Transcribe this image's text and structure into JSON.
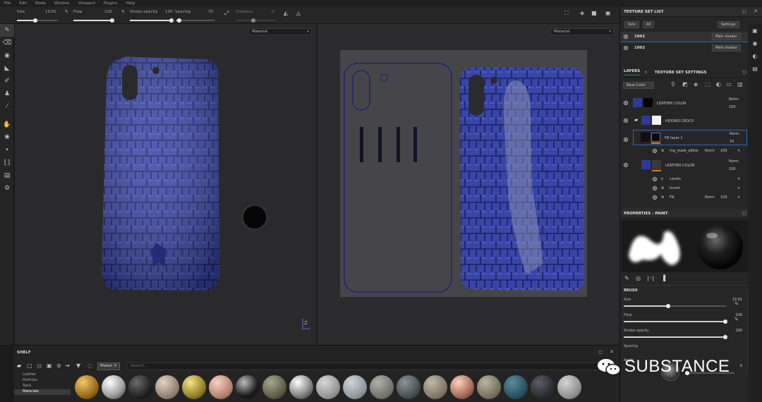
{
  "menu": [
    "File",
    "Edit",
    "Mode",
    "Window",
    "Viewport",
    "Plugins",
    "Help"
  ],
  "toolbar": {
    "size_label": "Size",
    "size_value": "19.01",
    "flow_label": "Flow",
    "flow_value": "100",
    "stroke_opacity_label": "Stroke opacity",
    "stroke_opacity_value": "100",
    "spacing_label": "Spacing",
    "spacing_value": "70",
    "distance_label": "Distance",
    "distance_value": "0"
  },
  "viewport3d": {
    "mode_select": "Material",
    "axis_label": "Z"
  },
  "viewport2d": {
    "mode_select": "Material"
  },
  "shelf": {
    "title": "SHELF",
    "filter_chip": "Materi",
    "search_placeholder": "Search...",
    "categories": [
      "Leather",
      "Particles",
      "Tools",
      "Materials"
    ],
    "selected_category": "Materials"
  },
  "texture_set_list": {
    "title": "TEXTURE SET LIST",
    "solo_button": "Solo",
    "all_button": "All",
    "settings_button": "Settings",
    "sets": [
      {
        "name": "1001",
        "shader": "Main shader"
      },
      {
        "name": "1002",
        "shader": "Main shader"
      }
    ]
  },
  "layers": {
    "tab_layers": "LAYERS",
    "tab_settings": "TEXTURE SET SETTINGS",
    "channel_select": "Base Color",
    "items": [
      {
        "name": "LEATHER COLOR",
        "blend": "Norm",
        "opacity": "100"
      },
      {
        "name": "HIDORO CROCO",
        "blend": "",
        "opacity": ""
      },
      {
        "name": "Fill layer 1",
        "blend": "Norm",
        "opacity": "15"
      },
      {
        "name": "mg_mask_editor",
        "blend": "Norm",
        "opacity": "100"
      },
      {
        "name": "LEATHER COLOR",
        "blend": "Norm",
        "opacity": "100"
      },
      {
        "name": "Levels",
        "blend": "",
        "opacity": ""
      },
      {
        "name": "Invert",
        "blend": "",
        "opacity": ""
      },
      {
        "name": "Fill",
        "blend": "Norm",
        "opacity": "100"
      }
    ]
  },
  "properties": {
    "title": "PROPERTIES - PAINT",
    "section": "BRUSH",
    "size_label": "Size",
    "size_value": "19.01",
    "flow_label": "Flow",
    "flow_value": "100",
    "stroke_opacity_label": "Stroke opacity",
    "stroke_opacity_value": "100",
    "spacing_label": "Spacing",
    "angle_label": "Angle",
    "angle_value": "0"
  },
  "watermark": "SUBSTANCE",
  "colors": {
    "leather_blue": "#3a45a8",
    "accent_orange": "#e07a20",
    "bg": "#1b1b1c"
  }
}
